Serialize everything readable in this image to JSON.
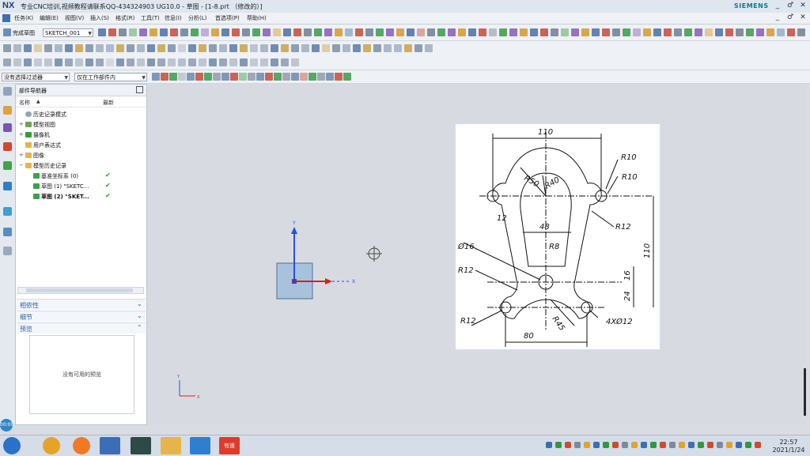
{
  "window": {
    "logo": "NX",
    "title": "专业CNC培训,视频教程请联系QQ-434324903 UG10.0 - 草图 - [1-8.prt （修改的）]",
    "brand": "SIEMENS",
    "minimize": "_",
    "restore": "♂",
    "close": "✕"
  },
  "menu": {
    "items": [
      "任务(K)",
      "编辑(E)",
      "视图(V)",
      "插入(S)",
      "格式(R)",
      "工具(T)",
      "信息(I)",
      "分析(L)",
      "首选项(P)",
      "帮助(H)"
    ],
    "min": "_",
    "restore": "♂",
    "close": "✕"
  },
  "toolbar": {
    "finish_sketch": "完成草图",
    "sketch_name": "SKETCH_001",
    "filter_select": "没有选择过滤器",
    "scope_select": "仅在工作部件内"
  },
  "navigator": {
    "title": "部件导航器",
    "col_name": "名称",
    "col_latest": "最新",
    "rows": [
      {
        "label": "历史记录模式",
        "indent": 0,
        "latest": ""
      },
      {
        "label": "模型视图",
        "indent": 0,
        "latest": ""
      },
      {
        "label": "摄像机",
        "indent": 0,
        "latest": ""
      },
      {
        "label": "用户表达式",
        "indent": 0,
        "latest": ""
      },
      {
        "label": "图像",
        "indent": 0,
        "latest": ""
      },
      {
        "label": "模型历史记录",
        "indent": 0,
        "latest": ""
      },
      {
        "label": "基准坐标系 (0)",
        "indent": 1,
        "latest": "✔"
      },
      {
        "label": "草图 (1) \"SKETC...",
        "indent": 1,
        "latest": "✔"
      },
      {
        "label": "草图 (2) \"SKET...",
        "indent": 1,
        "latest": "✔"
      }
    ],
    "sections": [
      "相依性",
      "细节",
      "预览"
    ],
    "preview_text": "没有可用的预览"
  },
  "graphics": {
    "axis_y": "Y",
    "axis_x": "X",
    "mini_axis_y": "Y",
    "mini_axis_x": "X"
  },
  "drawing": {
    "dims": {
      "top_width": "110",
      "r10_a": "R10",
      "r10_b": "R10",
      "r50": "R50",
      "r40": "R40",
      "angle12": "12",
      "r12_right": "R12",
      "w48": "48",
      "r8": "R8",
      "phi16": "Ø16",
      "h110": "110",
      "r12_left": "R12",
      "h16": "16",
      "h24": "24",
      "r12_bottom": "R12",
      "r45": "R45",
      "holes": "4XØ12",
      "w80": "80"
    }
  },
  "taskbar": {
    "time": "22:57",
    "date": "2021/1/24",
    "app_label": "有道"
  },
  "side_badge": "00:00"
}
